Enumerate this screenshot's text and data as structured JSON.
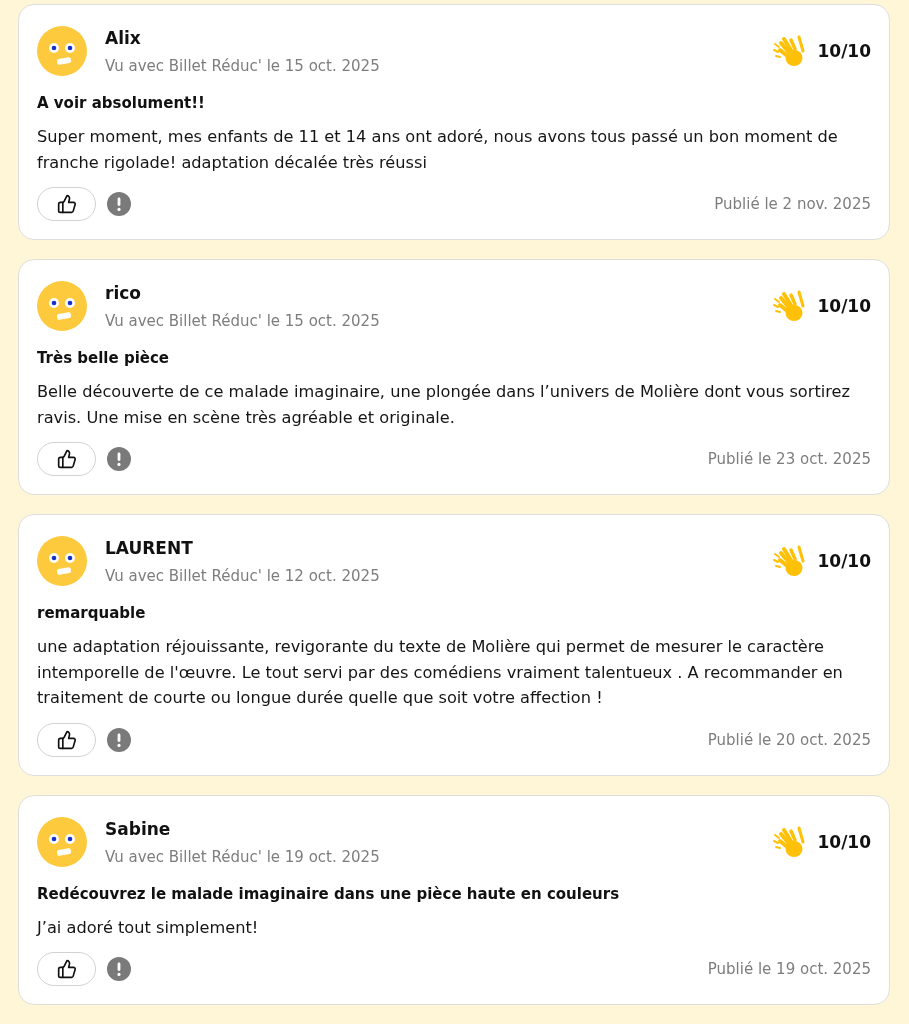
{
  "reviews": [
    {
      "author": "Alix",
      "seen": "Vu avec Billet Réduc' le 15 oct. 2025",
      "score": "10/10",
      "title": "A voir absolument!!",
      "body": "Super moment, mes enfants de 11 et 14 ans ont adoré, nous avons tous passé un bon moment de franche rigolade! adaptation décalée très réussi",
      "published": "Publié le 2 nov. 2025"
    },
    {
      "author": "rico",
      "seen": "Vu avec Billet Réduc' le 15 oct. 2025",
      "score": "10/10",
      "title": "Très belle pièce",
      "body": "Belle découverte de ce malade imaginaire, une plongée dans l’univers de Molière dont vous sortirez ravis. Une mise en scène très agréable et originale.",
      "published": "Publié le 23 oct. 2025"
    },
    {
      "author": "LAURENT",
      "seen": "Vu avec Billet Réduc' le 12 oct. 2025",
      "score": "10/10",
      "title": "remarquable",
      "body": "une adaptation réjouissante, revigorante du texte de Molière qui permet de mesurer le caractère intemporelle de l'œuvre. Le tout servi par des comédiens vraiment talentueux . A recommander en traitement de courte ou longue durée quelle que soit votre affection !",
      "published": "Publié le 20 oct. 2025"
    },
    {
      "author": "Sabine",
      "seen": "Vu avec Billet Réduc' le 19 oct. 2025",
      "score": "10/10",
      "title": "Redécouvrez le malade imaginaire dans une pièce haute en couleurs",
      "body": "J’ai adoré tout simplement!",
      "published": "Publié le 19 oct. 2025"
    }
  ]
}
